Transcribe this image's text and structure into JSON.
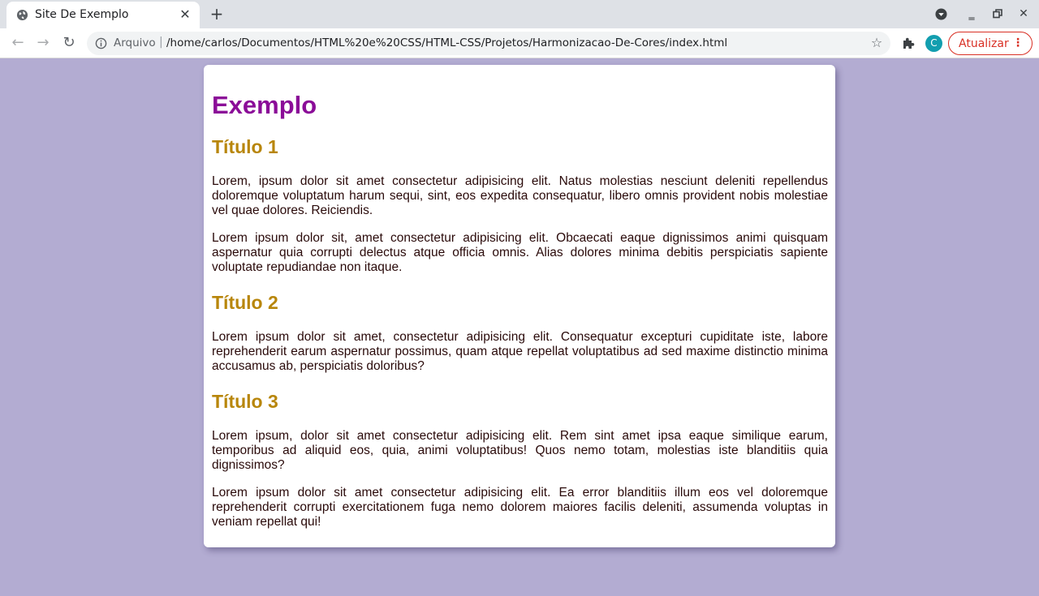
{
  "browser": {
    "tab_title": "Site De Exemplo",
    "omnibox": {
      "scheme_label": "Arquivo",
      "url": "/home/carlos/Documentos/HTML%20e%20CSS/HTML-CSS/Projetos/Harmonizacao-De-Cores/index.html"
    },
    "profile_initial": "C",
    "update_label": "Atualizar",
    "icons": [
      "globe-icon",
      "close-icon",
      "plus-icon",
      "back-arrow-icon",
      "forward-arrow-icon",
      "reload-icon",
      "info-icon",
      "star-icon",
      "puzzle-icon",
      "kebab-menu-icon",
      "media-icon",
      "minimize-icon",
      "restore-icon",
      "window-close-icon"
    ]
  },
  "page": {
    "heading": "Exemplo",
    "sections": [
      {
        "title": "Título 1",
        "paragraphs": [
          "Lorem, ipsum dolor sit amet consectetur adipisicing elit. Natus molestias nesciunt deleniti repellendus doloremque voluptatum harum sequi, sint, eos expedita consequatur, libero omnis provident nobis molestiae vel quae dolores. Reiciendis.",
          "Lorem ipsum dolor sit, amet consectetur adipisicing elit. Obcaecati eaque dignissimos animi quisquam aspernatur quia corrupti delectus atque officia omnis. Alias dolores minima debitis perspiciatis sapiente voluptate repudiandae non itaque."
        ]
      },
      {
        "title": "Título 2",
        "paragraphs": [
          "Lorem ipsum dolor sit amet, consectetur adipisicing elit. Consequatur excepturi cupiditate iste, labore reprehenderit earum aspernatur possimus, quam atque repellat voluptatibus ad sed maxime distinctio minima accusamus ab, perspiciatis doloribus?"
        ]
      },
      {
        "title": "Título 3",
        "paragraphs": [
          "Lorem ipsum, dolor sit amet consectetur adipisicing elit. Rem sint amet ipsa eaque similique earum, temporibus ad aliquid eos, quia, animi voluptatibus! Quos nemo totam, molestias iste blanditiis quia dignissimos?",
          "Lorem ipsum dolor sit amet consectetur adipisicing elit. Ea error blanditiis illum eos vel doloremque reprehenderit corrupti exercitationem fuga nemo dolorem maiores facilis deleniti, assumenda voluptas in veniam repellat qui!"
        ]
      }
    ]
  },
  "colors": {
    "page_background": "#b3acd2",
    "heading": "#8b0d98",
    "section_title": "#b8860b",
    "body_text": "#2a0a0a",
    "update_accent": "#d93025"
  }
}
